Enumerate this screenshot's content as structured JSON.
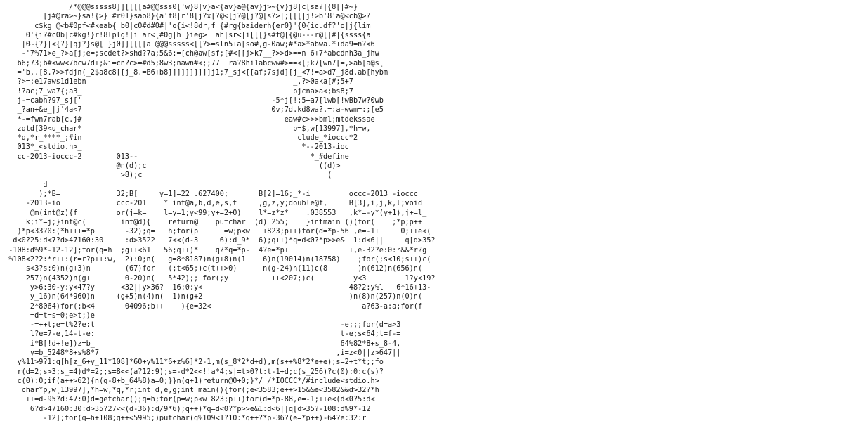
{
  "document": {
    "lines": [
      "                /*@@@sssss8]][[[[a#@@sss0['w}8|v}a<{av}a@{av}j>~{v}j8|c[sa?|{8[|#~}",
      "          [j#@ra>~}sa!{>}|#r01}sao8}{a'f8|r'8[j?x[?@<[j?@[j?@[s?>|;[[[|j!>b'8'a@<cb@>?",
      "        c$kg_@<b#0pf<#keab{_b0|c0#d#0#|'o{i<!8dr,f_{#rg{baiderh{er0}'{0{ic.df?'o|j{lim",
      "      0'{i?#c0b|c#kg!}r!8lplg!|i_ar<[#0g|h_}ieg>|_ah|sr<|i[[[}s#f@[{@u---r@[|#|{ssss{a",
      "     |0~{?}|<{?}|qj?}s@[_}j0]][[[[a_@@@sssss<[[?>=sln5+a[so#,g-0aw;#*a>*abwa.*+da9=n?<6",
      "     -'7%71>e_?>a[j;e=;scdet?>shd?7a;5&6:=[ch@aw[sf;[#<[[j>k7__?>>d>==n'6+7*abcdnh3a_jhw",
      "    b6;73;b#<ww<7bcw7d+;&i=cn?c>=#d5;8w3;nawn#<;;77__ra?8hi1abcww#>==<[;k7[wn7[=,>ab[a@s[",
      "    ='b,.[8.7>>fdjn(_2$a8c8[[j_8.=B6+b8]]]]]]]]]]j1;7_sj<[[af;7sjd][j_<7!=a>d7_j8d.ab[hybm",
      "    ?>=;e17aws1d1ebn                                                _,?>0aka[#;5+7",
      "    !?ac;7_wa7{;a3_                                                 bjcna>a<;bs8;7",
      "    j-=cabh?97_sj['                                            -5*j[!;5+a7[lwb[!wBb7w?0wb",
      "    _?an+&e_|j'4a<7                                            0v;7d.kd8wa?.=:a-wwm=:;[e5",
      "    *-=fwn7rab[c.j#                                               eaw#c>>>bml;mtdekssae",
      "    zqtd[39<u_char*                                                 p=$,w[13997],*h=w,",
      "    *q,*r_****_;#in                                                  clude_*ioccc*2",
      "    013*_<stdio.h>_                                                   *--2013-ioc",
      "    cc-2013-ioccc-2        013--                                        *_#define",
      "                           @n(d);c                                        ((d)>",
      "                            >8);c                                           (",
      "          d",
      "         );*B=             32;B[     y=1]=22 .627400;       B[2]=16;_*-i         occc-2013 -ioccc",
      "      -2013-io             ccc-201    *_int@a,b,d,e,s,t     ,g,z,y;double@f,     B[3],i,j,k,l;void",
      "       @m(int@z){f         or(j=k=    l=y=1;y<99;y+=2+0)    l*=z*z*    .038553   ,k*=-y*(y+1),j+=l_",
      "      k;i*=j;}int@c(        int@d){    return@    putchar  (d)_255;    }intmain ()(for(    ;*p;p++",
      "    )*p<33?0:(*h+++=*p       -32);q=   h;for(p      =w;p<w   +823;p++)for(d=*p-56 ,e=-1+     0;++e<(",
      "   d<0?25:d<7?d>47160:30     :d>3522   7<<(d-3     6):d_9*  6);q++)*q=d<0?*p>>e&  1:d<6||     q[d>35?",
      "  -108:d%9*-12-12];for(q=h  ;g++<61   56;q++)*    q?*q=*p-  4?e=*p+              +,e-32?e:0:r&&*r?g",
      "  %108<2?2:*r++:(r=r?p++:w,  2):0;n(   g=8*8187)n(g+8)n(1    6)n(19014)n(18758)    ;for(;s<10;s++)c(",
      "      s<3?s:0)n(g+3)n        (67)for   (;t<65;)c(t++>0)      n(g-24)n(11)c(8       )n(612)n(656)n(",
      "      257)n(4352)n(g+        0-20)n(   5*42);; for(;y          ++<207;)c(         y<3         1?y<19?",
      "       y>6:30-y:y<47?y      <32||y>36?  16:0:y<                                  48?2:y%l   6*16+13-",
      "       y_16)n(64*960)n     (g+5)n(4)n(  1)n(g+2                                  )n(8)n(257)n(0)n(",
      "       2*8064)for(;b<4       04096;b++    ){e=32<                                   a?63-a:a;for(f",
      "       =d=t=s=0;e>t;)e",
      "       -=++t;e=t%2?e:t                                                         -e;;;for(d=a>3",
      "       l?e=7-e,14-t-e:                                                         t-e;s<64;t=f-=",
      "       i*B[!d+!e])z=b_                                                         64%82*8+s_8-4,",
      "       y=b_5248*8+s%8*7                                                       ,i=z<0||z>647||",
      "    y%11>9?1:q[h[z_6+y_11*108]*60+y%11*6+z%6]*2-1,m(s_8*2*d+d),m(s++%8*2*e+e);s=2+t*t;;fo",
      "    r(d=2;s>3;s_=4)d*=2;;s=8<<(a?12:9);s=-d*2<<!!a*4;s|=t>0?t:t-1+d;c(s_256)?c(0):0:c(s)?",
      "    c(0):0;if(a++>62){n(g-8+b_64%8)a=0;}}n(g+1)return@0+0;}*/ /*IOCCC*/#include<stdio.h>",
      "     char*p,w[13997],*h=w,*q,*r;int d,e,g;int main(){for(;e<3583;e++>15&&e<3582&&d>32?*h",
      "      ++=d-95?d:47:0)d=getchar();q=h;for(p=w;p<w+823;p++)for(d=*p-88,e=-1;++e<(d<0?5:d<",
      "       6?d>47160:30:d>35?27<<(d-36):d/9*6);q++)*q=d<0?*p>>e&1:d<6||q[d>35?-108:d%9*-12",
      "          -12];for(q=h+108;g++<5995;)putchar(g%109<1?10:*q++?*p-36?(e=*p++)-64?e:32:r",
      "                /*IOCCC2013*/&&*r?g%109%108<2?34:*r++:(r=r?p++:w,34):32);return 0;}"
    ]
  }
}
